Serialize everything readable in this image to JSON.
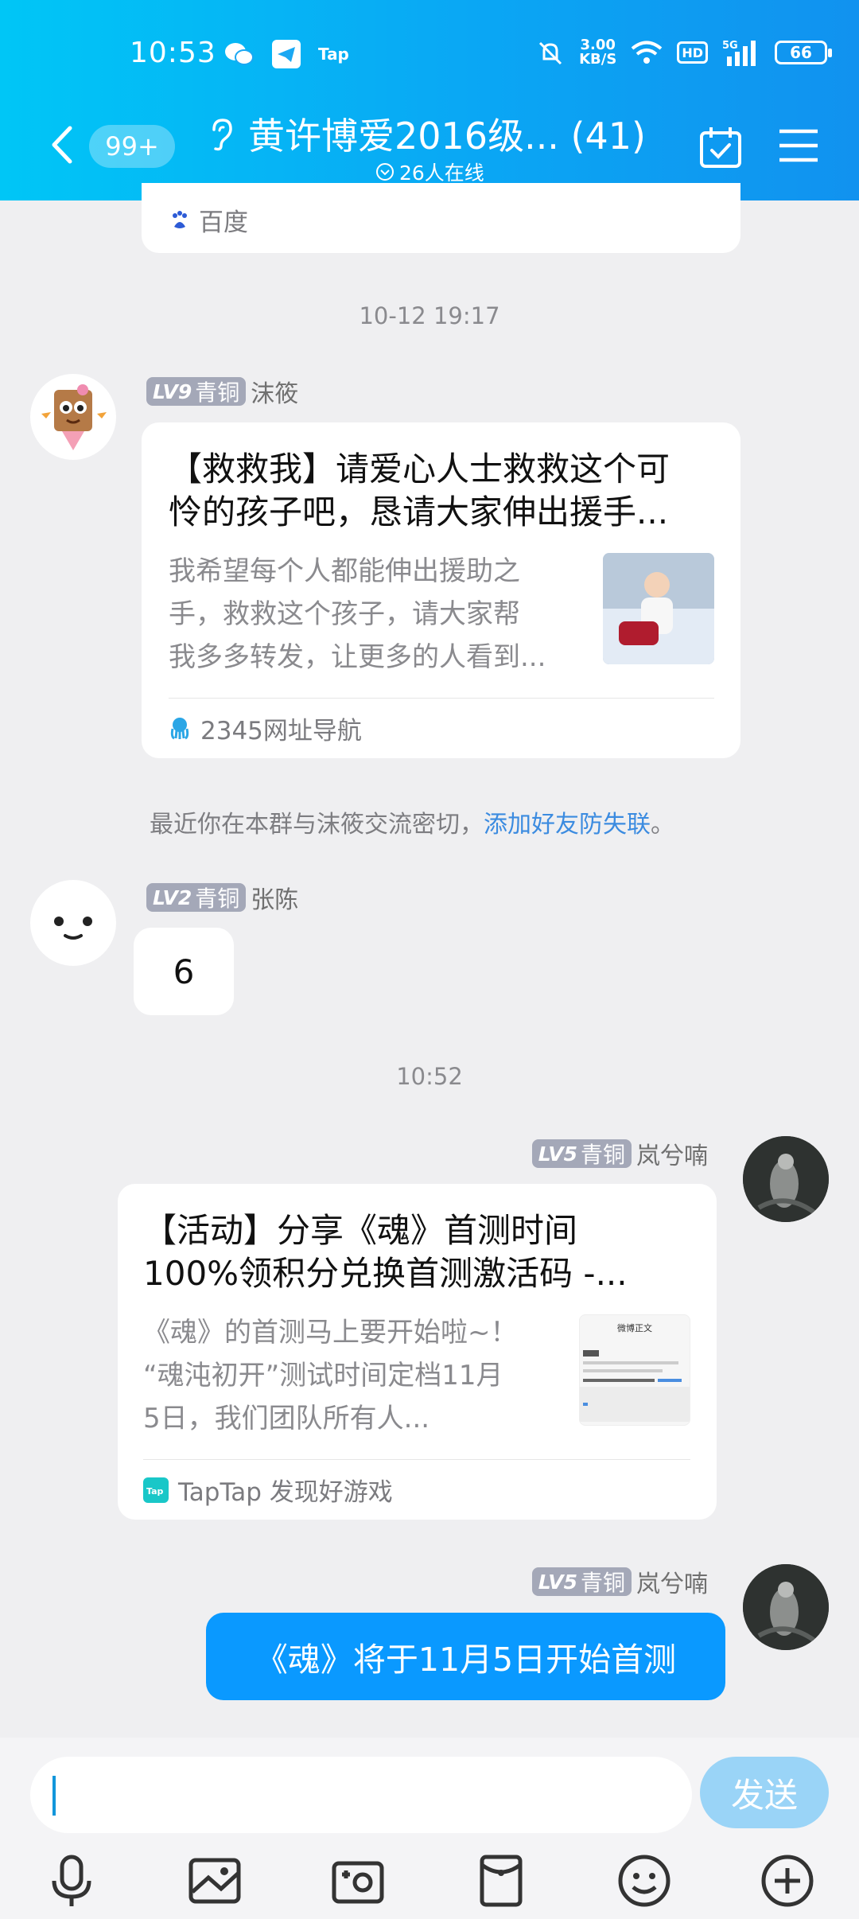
{
  "status_bar": {
    "time": "10:53",
    "tap": "Tap",
    "speed_top": "3.00",
    "speed_bottom": "KB/S",
    "hd": "HD",
    "network": "5G",
    "battery": "66"
  },
  "header": {
    "unread": "99+",
    "title": "黄许博爱2016级... (41)",
    "online": "26人在线"
  },
  "messages": {
    "prev_card_source": "百度",
    "ts1": "10-12 19:17",
    "m1": {
      "level": "LV9",
      "rank": "青铜",
      "name": "沫筱",
      "title_line1": "【救救我】请爱心人士救救这个可",
      "title_line2": "怜的孩子吧，恳请大家伸出援手...",
      "desc_line1": "我希望每个人都能伸出援助之",
      "desc_line2": "手，救救这个孩子，请大家帮",
      "desc_line3": "我多多转发，让更多的人看到...",
      "source": "2345网址导航"
    },
    "notice_text": "最近你在本群与沫筱交流密切，",
    "notice_link": "添加好友防失联",
    "notice_end": "。",
    "m2": {
      "level": "LV2",
      "rank": "青铜",
      "name": "张陈",
      "text": "6"
    },
    "ts2": "10:52",
    "m3": {
      "level": "LV5",
      "rank": "青铜",
      "name": "岚兮喃",
      "title_line1": "【活动】分享《魂》首测时间",
      "title_line2": "100%领积分兑换首测激活码 -...",
      "desc_line1": "《魂》的首测马上要开始啦~！",
      "desc_line2": "“魂沌初开”测试时间定档11月",
      "desc_line3": "5日，我们团队所有人...",
      "source": "TapTap 发现好游戏",
      "thumb_title": "微博正文"
    },
    "m4": {
      "level": "LV5",
      "rank": "青铜",
      "name": "岚兮喃",
      "text": "《魂》将于11月5日开始首测"
    }
  },
  "input": {
    "send_label": "发送"
  },
  "toolbar": {
    "icons": [
      "mic-icon",
      "image-icon",
      "camera-icon",
      "red-packet-icon",
      "emoji-icon",
      "plus-icon"
    ]
  },
  "colors": {
    "header_start": "#00c6f6",
    "header_end": "#1192ef",
    "bubble_self": "#0a99ff",
    "link": "#3b8be0",
    "send_disabled": "#9ad4f7"
  }
}
